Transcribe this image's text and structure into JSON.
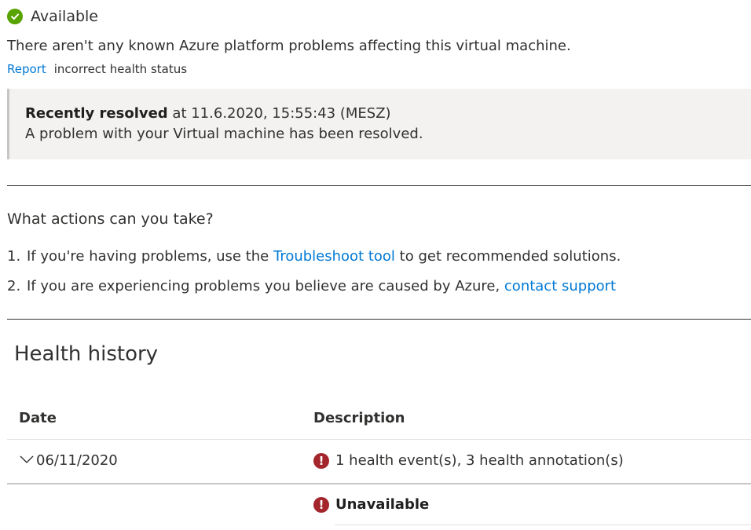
{
  "status": {
    "icon": "checkmark-circle-icon",
    "label": "Available",
    "description": "There aren't any known Azure platform problems affecting this virtual machine.",
    "report_link": "Report",
    "report_rest": "incorrect health status",
    "color_ok": "#57a300"
  },
  "resolved": {
    "bold": "Recently resolved",
    "timestamp": " at 11.6.2020, 15:55:43 (MESZ)",
    "message": "A problem with your Virtual machine has been resolved."
  },
  "actions": {
    "question": "What actions can you take?",
    "items": [
      {
        "num": "1.",
        "before": "If you're having problems, use the ",
        "link": "Troubleshoot tool",
        "after": " to get recommended solutions."
      },
      {
        "num": "2.",
        "before": "If you are experiencing problems you believe are caused by Azure, ",
        "link": "contact support",
        "after": ""
      }
    ]
  },
  "history": {
    "title": "Health history",
    "columns": {
      "date": "Date",
      "description": "Description"
    },
    "rows": [
      {
        "date": "06/11/2020",
        "description": "1 health event(s), 3 health annotation(s)",
        "icon": "error-icon",
        "expanded": true
      }
    ],
    "sub_rows": [
      {
        "description": "Unavailable",
        "icon": "error-icon"
      }
    ]
  },
  "colors": {
    "link": "#0078d4",
    "error": "#a4262c",
    "resolved_bg": "#f3f2f1"
  }
}
